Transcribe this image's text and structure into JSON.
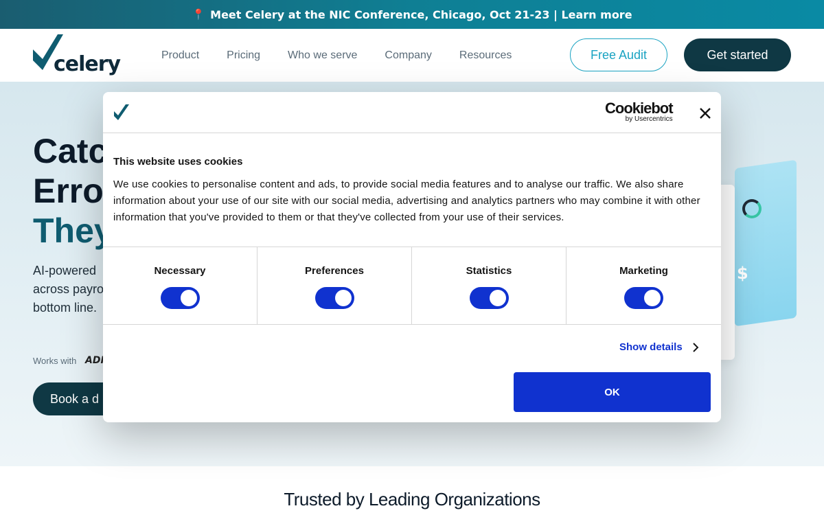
{
  "announcement": {
    "pin_icon": "📍",
    "text": "Meet Celery at the NIC Conference, Chicago, Oct 21-23 | Learn more"
  },
  "header": {
    "logo_text": "celery",
    "nav": [
      "Product",
      "Pricing",
      "Who we serve",
      "Company",
      "Resources"
    ],
    "free_audit": "Free Audit",
    "get_started": "Get started"
  },
  "hero": {
    "title_line1": "Catc",
    "title_line2": "Erro",
    "title_line3": "They",
    "subtitle_line1": "AI-powered",
    "subtitle_line2": "across payro",
    "subtitle_line3": "bottom line.",
    "works_with": "Works with",
    "partner_logo": "ADP",
    "book_demo": "Book a d"
  },
  "trusted": {
    "title": "Trusted by Leading Organizations"
  },
  "cookie_dialog": {
    "brand": "Cookiebot",
    "brand_sub": "by Usercentrics",
    "title": "This website uses cookies",
    "text": "We use cookies to personalise content and ads, to provide social media features and to analyse our traffic. We also share information about your use of our site with our social media, advertising and analytics partners who may combine it with other information that you've provided to them or that they've collected from your use of their services.",
    "toggles": [
      {
        "label": "Necessary",
        "on": true
      },
      {
        "label": "Preferences",
        "on": true
      },
      {
        "label": "Statistics",
        "on": true
      },
      {
        "label": "Marketing",
        "on": true
      }
    ],
    "show_details": "Show details",
    "ok": "OK"
  },
  "colors": {
    "brand_dark": "#0f3844",
    "accent_teal": "#1aa3c2",
    "cookie_blue": "#1032cf"
  }
}
